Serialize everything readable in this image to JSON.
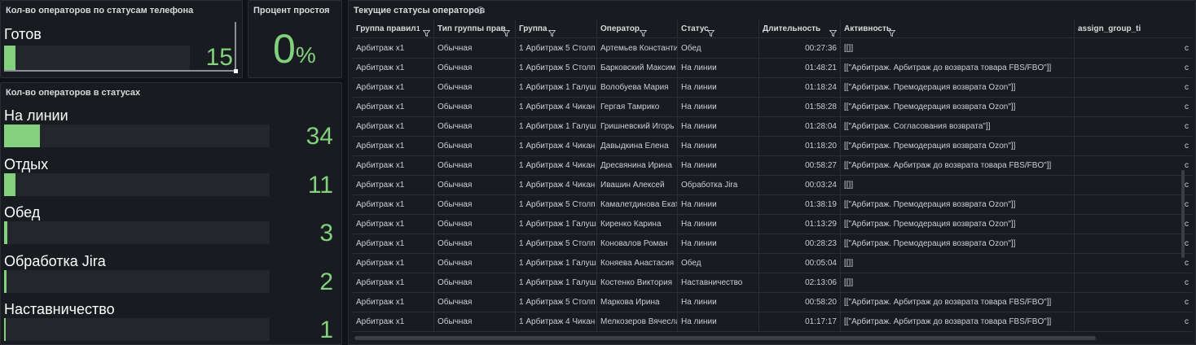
{
  "panel_phone_status": {
    "title": "Кол-во операторов по статусам телефона",
    "label": "Готов",
    "value": "15",
    "fill_fraction": 0.06
  },
  "panel_idle": {
    "title": "Процент простоя",
    "value": "0",
    "unit": "%"
  },
  "panel_statuses": {
    "title": "Кол-во операторов в статусах",
    "items": [
      {
        "label": "На линии",
        "value": "34",
        "fill_fraction": 0.135
      },
      {
        "label": "Отдых",
        "value": "11",
        "fill_fraction": 0.043
      },
      {
        "label": "Обед",
        "value": "3",
        "fill_fraction": 0.012
      },
      {
        "label": "Обработка Jira",
        "value": "2",
        "fill_fraction": 0.008
      },
      {
        "label": "Наставничество",
        "value": "1",
        "fill_fraction": 0.004
      }
    ]
  },
  "table_panel": {
    "title": "Текущие статусы операторов",
    "info_icon": "i",
    "columns": [
      {
        "label": "Группа правил",
        "sort": "1"
      },
      {
        "label": "Тип группы прав"
      },
      {
        "label": "Группа"
      },
      {
        "label": "Оператор"
      },
      {
        "label": "Статус"
      },
      {
        "label": "Длительность"
      },
      {
        "label": "Активность"
      },
      {
        "label": "assign_group_ti"
      }
    ],
    "rows": [
      [
        "Арбитраж х1",
        "Обычная",
        "1 Арбитраж 5 Столп",
        "Артемьев Константи",
        "Обед",
        "00:27:36",
        "[[]]",
        "c"
      ],
      [
        "Арбитраж х1",
        "Обычная",
        "1 Арбитраж 5 Столп",
        "Барковский Максим",
        "На линии",
        "01:48:21",
        "[[\"Арбитраж. Арбитраж до возврата товара FBS/FBO\"]]",
        "c"
      ],
      [
        "Арбитраж х1",
        "Обычная",
        "1 Арбитраж 1 Галуш",
        "Волобуева Мария",
        "На линии",
        "01:18:24",
        "[[\"Арбитраж. Премодерация возврата Ozon\"]]",
        "c"
      ],
      [
        "Арбитраж х1",
        "Обычная",
        "1 Арбитраж 4 Чикан",
        "Гергая Тамрико",
        "На линии",
        "01:58:28",
        "[[\"Арбитраж. Премодерация возврата Ozon\"]]",
        "c"
      ],
      [
        "Арбитраж х1",
        "Обычная",
        "1 Арбитраж 1 Галуш",
        "Гришневский Игорь",
        "На линии",
        "01:28:04",
        "[[\"Арбитраж. Согласования возврата\"]]",
        "c"
      ],
      [
        "Арбитраж х1",
        "Обычная",
        "1 Арбитраж 4 Чикан",
        "Давыдкина Елена",
        "На линии",
        "01:18:20",
        "[[\"Арбитраж. Премодерация возврата Ozon\"]]",
        "c"
      ],
      [
        "Арбитраж х1",
        "Обычная",
        "1 Арбитраж 4 Чикан",
        "Дресвянина Ирина",
        "На линии",
        "00:58:27",
        "[[\"Арбитраж. Арбитраж до возврата товара FBS/FBO\"]]",
        "c"
      ],
      [
        "Арбитраж х1",
        "Обычная",
        "1 Арбитраж 4 Чикан",
        "Ивашин Алексей",
        "Обработка Jira",
        "00:03:24",
        "[[]]",
        "c"
      ],
      [
        "Арбитраж х1",
        "Обычная",
        "1 Арбитраж 5 Столп",
        "Камалетдинова Екат",
        "На линии",
        "01:38:19",
        "[[\"Арбитраж. Премодерация возврата Ozon\"]]",
        "c"
      ],
      [
        "Арбитраж х1",
        "Обычная",
        "1 Арбитраж 1 Галуш",
        "Киренко Карина",
        "На линии",
        "01:13:29",
        "[[\"Арбитраж. Премодерация возврата Ozon\"]]",
        "c"
      ],
      [
        "Арбитраж х1",
        "Обычная",
        "1 Арбитраж 5 Столп",
        "Коновалов Роман",
        "На линии",
        "00:28:23",
        "[[\"Арбитраж. Премодерация возврата Ozon\"]]",
        "c"
      ],
      [
        "Арбитраж х1",
        "Обычная",
        "1 Арбитраж 1 Галуш",
        "Коняева Анастасия",
        "Обед",
        "00:05:04",
        "[[]]",
        "c"
      ],
      [
        "Арбитраж х1",
        "Обычная",
        "1 Арбитраж 1 Галуш",
        "Костенко Виктория",
        "Наставничество",
        "02:13:06",
        "[[]]",
        "c"
      ],
      [
        "Арбитраж х1",
        "Обычная",
        "1 Арбитраж 5 Столп",
        "Маркова Ирина",
        "На линии",
        "00:58:20",
        "[[\"Арбитраж. Арбитраж до возврата товара FBS/FBO\"]]",
        "c"
      ],
      [
        "Арбитраж х1",
        "Обычная",
        "1 Арбитраж 4 Чикан",
        "Мелкозеров Вячесла",
        "На линии",
        "01:17:17",
        "[[\"Арбитраж. Арбитраж до возврата товара FBS/FBO\"]]",
        "c"
      ]
    ]
  },
  "colors": {
    "background": "#111217",
    "panel": "#181b1f",
    "accent_green": "#83d07f",
    "bar_track": "#23262c"
  }
}
